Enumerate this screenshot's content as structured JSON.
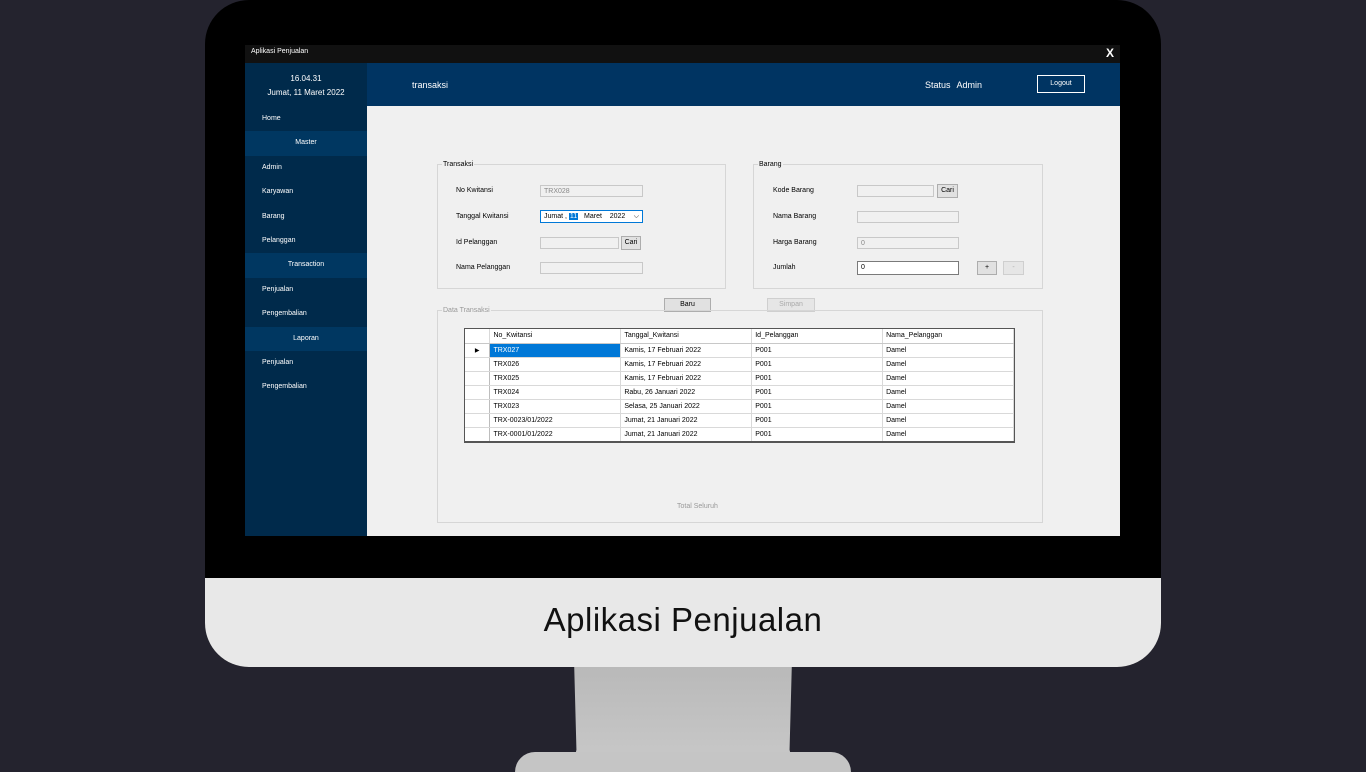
{
  "window": {
    "title": "Aplikasi Penjualan",
    "close": "X"
  },
  "monitor_caption": "Aplikasi Penjualan",
  "sidebar": {
    "time": "16.04.31",
    "date": "Jumat, 11 Maret 2022",
    "items": [
      {
        "label": "Home",
        "sub": false
      },
      {
        "label": "Master",
        "sub": true
      },
      {
        "label": "Admin",
        "sub": false
      },
      {
        "label": "Karyawan",
        "sub": false
      },
      {
        "label": "Barang",
        "sub": false
      },
      {
        "label": "Pelanggan",
        "sub": false
      },
      {
        "label": "Transaction",
        "sub": true
      },
      {
        "label": "Penjualan",
        "sub": false
      },
      {
        "label": "Pengembalian",
        "sub": false
      },
      {
        "label": "Laporan",
        "sub": true
      },
      {
        "label": "Penjualan",
        "sub": false
      },
      {
        "label": "Pengembalian",
        "sub": false
      }
    ]
  },
  "topbar": {
    "form_title": "transaksi",
    "status_label": "Status",
    "status_value": "Admin",
    "logout": "Logout"
  },
  "transaksi": {
    "legend": "Transaksi",
    "no_kwitansi_label": "No Kwitansi",
    "no_kwitansi_value": "TRX028",
    "tanggal_label": "Tanggal Kwitansi",
    "tanggal_day": "Jumat ,",
    "tanggal_date": "11",
    "tanggal_month": "Maret",
    "tanggal_year": "2022",
    "id_pelanggan_label": "Id Pelanggan",
    "id_pelanggan_value": "",
    "cari": "Cari",
    "nama_pelanggan_label": "Nama Pelanggan",
    "nama_pelanggan_value": ""
  },
  "barang": {
    "legend": "Barang",
    "kode_label": "Kode Barang",
    "kode_value": "",
    "cari": "Cari",
    "nama_label": "Nama Barang",
    "nama_value": "",
    "harga_label": "Harga Barang",
    "harga_value": "0",
    "jumlah_label": "Jumlah",
    "jumlah_value": "0",
    "plus": "+",
    "minus": "-"
  },
  "actions": {
    "baru": "Baru",
    "simpan": "Simpan"
  },
  "data_transaksi": {
    "legend": "Data Transaksi",
    "columns": [
      "No_Kwitansi",
      "Tanggal_Kwitansi",
      "Id_Pelanggan",
      "Nama_Pelanggan"
    ],
    "rows": [
      [
        "TRX027",
        "Kamis, 17 Februari 2022",
        "P001",
        "Damel"
      ],
      [
        "TRX026",
        "Kamis, 17 Februari 2022",
        "P001",
        "Damel"
      ],
      [
        "TRX025",
        "Kamis, 17 Februari 2022",
        "P001",
        "Damel"
      ],
      [
        "TRX024",
        "Rabu, 26 Januari 2022",
        "P001",
        "Damel"
      ],
      [
        "TRX023",
        "Selasa, 25 Januari 2022",
        "P001",
        "Damel"
      ],
      [
        "TRX-0023/01/2022",
        "Jumat, 21 Januari 2022",
        "P001",
        "Damel"
      ],
      [
        "TRX-0001/01/2022",
        "Jumat, 21 Januari 2022",
        "P001",
        "Damel"
      ]
    ],
    "current_row_marker": "▶",
    "total_label": "Total Seluruh"
  }
}
